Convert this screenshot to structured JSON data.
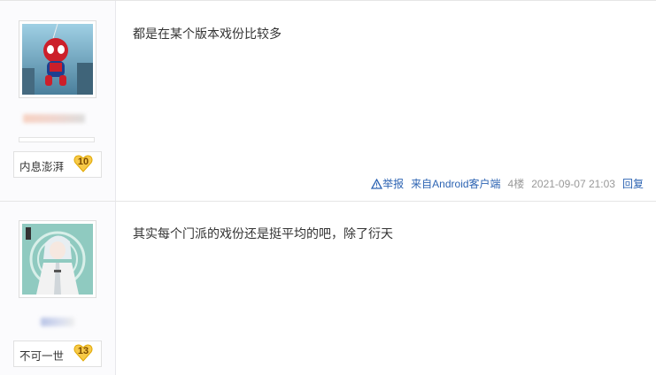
{
  "posts": [
    {
      "user": {
        "tag_name": "内息澎湃",
        "level": "10"
      },
      "content": "都是在某个版本戏份比较多",
      "tail": {
        "report": "举报",
        "source": "来自Android客户端",
        "floor": "4楼",
        "time": "2021-09-07 21:03",
        "reply": "回复"
      }
    },
    {
      "user": {
        "tag_name": "不可一世",
        "level": "13"
      },
      "content": "其实每个门派的戏份还是挺平均的吧，除了衍天"
    }
  ],
  "colors": {
    "link": "#2d64b3",
    "badge": "#f7c948",
    "meta": "#999999"
  }
}
